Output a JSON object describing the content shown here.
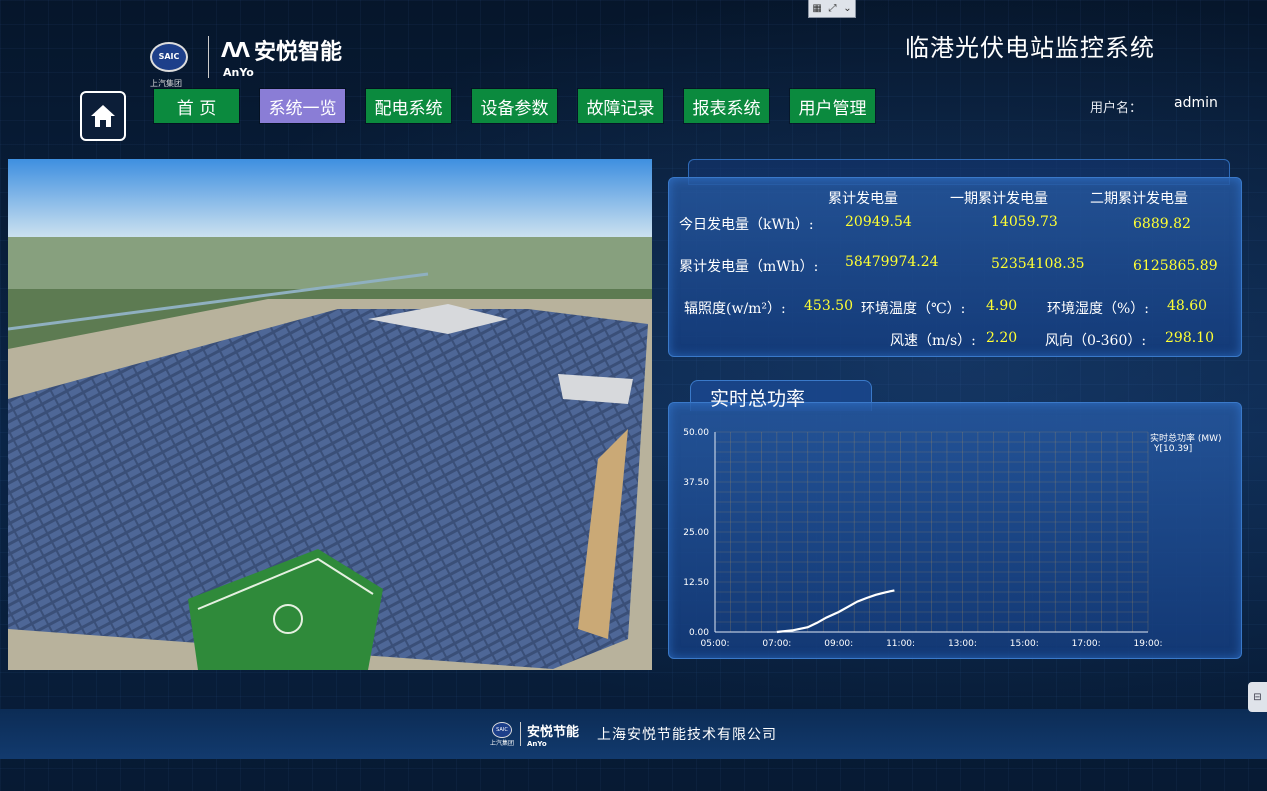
{
  "header": {
    "logo_saic": "SAIC",
    "logo_saic_sub": "上汽集团",
    "logo_anyo_cn": "安悦智能",
    "logo_anyo_en": "AnYo",
    "system_title": "临港光伏电站监控系统",
    "user_label": "用户名：",
    "user_name": "admin"
  },
  "nav": [
    {
      "label": "首 页",
      "active": false
    },
    {
      "label": "系统一览",
      "active": true
    },
    {
      "label": "配电系统",
      "active": false
    },
    {
      "label": "设备参数",
      "active": false
    },
    {
      "label": "故障记录",
      "active": false
    },
    {
      "label": "报表系统",
      "active": false
    },
    {
      "label": "用户管理",
      "active": false
    }
  ],
  "info": {
    "col_headers": [
      "累计发电量",
      "一期累计发电量",
      "二期累计发电量"
    ],
    "today_label": "今日发电量（kWh）:",
    "today_values": [
      "20949.54",
      "14059.73",
      "6889.82"
    ],
    "total_label": "累计发电量（mWh）:",
    "total_values": [
      "58479974.24",
      "52354108.35",
      "6125865.89"
    ],
    "irradiance_label": "辐照度(w/m²）:",
    "irradiance_value": "453.50",
    "temp_label": "环境温度（℃）:",
    "temp_value": "4.90",
    "humidity_label": "环境湿度（%）:",
    "humidity_value": "48.60",
    "wind_speed_label": "风速（m/s）:",
    "wind_speed_value": "2.20",
    "wind_dir_label": "风向（0-360）:",
    "wind_dir_value": "298.10"
  },
  "chart_data": {
    "type": "line",
    "title": "实时总功率",
    "legend_name": "实时总功率 (MW)",
    "legend_value": "Y[10.39]",
    "x_ticks": [
      "05:00:",
      "07:00:",
      "09:00:",
      "11:00:",
      "13:00:",
      "15:00:",
      "17:00:",
      "19:00:"
    ],
    "y_ticks": [
      "0.00",
      "12.50",
      "25.00",
      "37.50",
      "50.00"
    ],
    "xlim": [
      5,
      19
    ],
    "ylim": [
      0,
      50
    ],
    "grid": true,
    "series": [
      {
        "name": "实时总功率 (MW)",
        "x": [
          7.0,
          7.5,
          8.0,
          8.3,
          8.6,
          9.0,
          9.3,
          9.6,
          9.9,
          10.2,
          10.5,
          10.8
        ],
        "y": [
          0.0,
          0.4,
          1.2,
          2.3,
          3.6,
          5.0,
          6.3,
          7.6,
          8.5,
          9.3,
          9.9,
          10.39
        ]
      }
    ],
    "line_color": "#ffffff"
  },
  "footer": {
    "company": "上海安悦节能技术有限公司",
    "logo_text": "安悦节能",
    "logo_en": "AnYo",
    "logo_saic_sub": "上汽集团"
  }
}
